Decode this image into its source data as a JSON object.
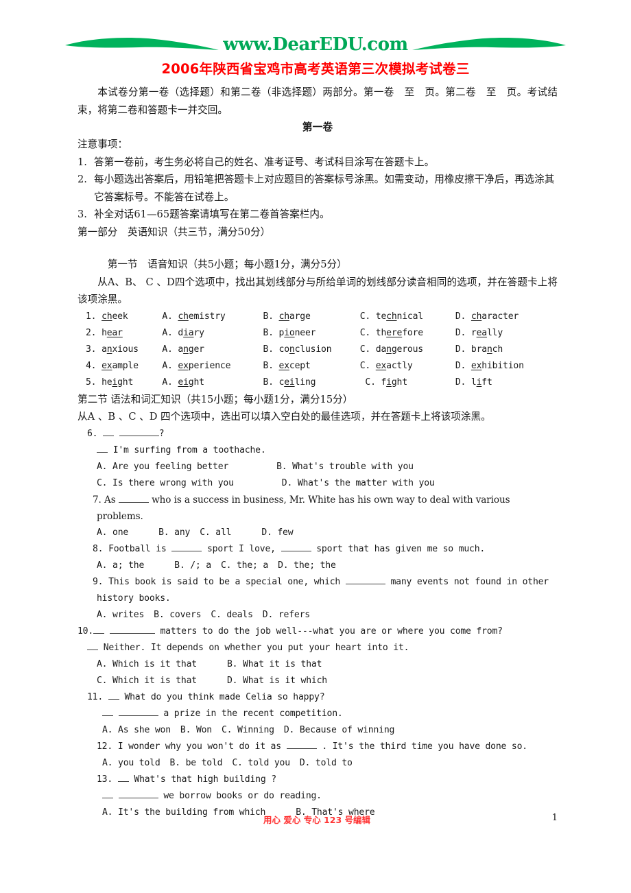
{
  "header": {
    "logo_text": "www.DearEDU.com",
    "logo_color": "#00a857",
    "title": "2006年陕西省宝鸡市高考英语第三次模拟考试卷三",
    "title_color": "#ff0000"
  },
  "intro": {
    "paragraph": "本试卷分第一卷（选择题）和第二卷（非选择题）两部分。第一卷　至　页。第二卷　至　页。考试结束，将第二卷和答题卡一并交回。",
    "volume_heading": "第一卷"
  },
  "notes": {
    "heading": "注意事项：",
    "items": [
      {
        "num": "1.",
        "text": "答第一卷前，考生务必将自己的姓名、准考证号、考试科目涂写在答题卡上。"
      },
      {
        "num": "2.",
        "text": "每小题选出答案后，用铅笔把答题卡上对应题目的答案标号涂黑。如需变动，用橡皮擦干净后，再选涂其它答案标号。不能答在试卷上。"
      },
      {
        "num": "3.",
        "text": "补全对话61—65题答案请填写在第二卷首答案栏内。"
      }
    ]
  },
  "part1": {
    "heading": "第一部分　英语知识（共三节，满分50分）",
    "section1": {
      "heading": "第一节　语音知识（共5小题；每小题1分，满分5分）",
      "instruction": "从A、B、 C 、D四个选项中，找出其划线部分与所给单词的划线部分读音相同的选项，并在答题卡上将该项涂黑。",
      "questions": [
        {
          "num": "1.",
          "stem": {
            "pre": "",
            "u": "ch",
            "post": "eek"
          },
          "options": [
            {
              "label": "A.",
              "pre": "",
              "u": "ch",
              "post": "emistry"
            },
            {
              "label": "B.",
              "pre": "",
              "u": "ch",
              "post": "arge"
            },
            {
              "label": "C.",
              "pre": "te",
              "u": "ch",
              "post": "nical"
            },
            {
              "label": "D.",
              "pre": "",
              "u": "ch",
              "post": "aracter"
            }
          ]
        },
        {
          "num": "2.",
          "stem": {
            "pre": "h",
            "u": "ear",
            "post": ""
          },
          "options": [
            {
              "label": "A.",
              "pre": "d",
              "u": "ia",
              "post": "ry"
            },
            {
              "label": "B.",
              "pre": "p",
              "u": "io",
              "post": "neer"
            },
            {
              "label": "C.",
              "pre": "th",
              "u": "ere",
              "post": "fore"
            },
            {
              "label": "D.",
              "pre": "r",
              "u": "ea",
              "post": "lly"
            }
          ]
        },
        {
          "num": "3.",
          "stem": {
            "pre": "a",
            "u": "n",
            "post": "xious"
          },
          "options": [
            {
              "label": "A.",
              "pre": "a",
              "u": "n",
              "post": "ger"
            },
            {
              "label": "B.",
              "pre": "co",
              "u": "n",
              "post": "clusion"
            },
            {
              "label": "C.",
              "pre": "da",
              "u": "n",
              "post": "gerous"
            },
            {
              "label": "D.",
              "pre": "bra",
              "u": "n",
              "post": "ch"
            }
          ]
        },
        {
          "num": "4.",
          "stem": {
            "pre": "",
            "u": "ex",
            "post": "ample"
          },
          "options": [
            {
              "label": "A.",
              "pre": "",
              "u": "ex",
              "post": "perience"
            },
            {
              "label": "B.",
              "pre": "",
              "u": "ex",
              "post": "cept"
            },
            {
              "label": "C.",
              "pre": "",
              "u": "ex",
              "post": "actly"
            },
            {
              "label": "D.",
              "pre": "",
              "u": "ex",
              "post": "hibition"
            }
          ]
        },
        {
          "num": "5.",
          "stem": {
            "pre": "he",
            "u": "i",
            "post": "ght"
          },
          "options": [
            {
              "label": "A.",
              "pre": "",
              "u": "ei",
              "post": "ght"
            },
            {
              "label": "B.",
              "pre": "c",
              "u": "ei",
              "post": "ling"
            },
            {
              "label": "C.",
              "pre": "f",
              "u": "i",
              "post": "ght"
            },
            {
              "label": "D.",
              "pre": "l",
              "u": "i",
              "post": "ft"
            }
          ]
        }
      ]
    },
    "section2": {
      "heading": "第二节 语法和词汇知识（共15小题；每小题1分，满分15分）",
      "instruction": "从A 、B 、C 、D 四个选项中，选出可以填入空白处的最佳选项，并在答题卡上将该项涂黑。"
    }
  },
  "questions": {
    "q6": {
      "num": "6.",
      "line1_suffix": "?",
      "line2": "I'm surfing from a toothache.",
      "optA": "A. Are you feeling better",
      "optB": "B. What's trouble with you",
      "optC": "C. Is there wrong with you",
      "optD": "D. What's the matter with you"
    },
    "q7": {
      "num": "7.",
      "stem_pre": "As",
      "stem_post": "who is a success in business, Mr. White has his own way to deal with various",
      "stem_cont": "problems.",
      "optA": "A. one",
      "optB": "B. any",
      "optC": "C. all",
      "optD": "D. few"
    },
    "q8": {
      "num": "8.",
      "stem_pre": "Football is",
      "stem_mid": "sport I love,",
      "stem_post": "sport that has given me so much.",
      "optA": "A. a; the",
      "optB": "B. /; a",
      "optC": "C. the; a",
      "optD": "D. the; the"
    },
    "q9": {
      "num": "9.",
      "stem_pre": "This book is said to be a special one, which",
      "stem_post": "many events not found in other",
      "stem_cont": "history books.",
      "optA": "A. writes",
      "optB": "B. covers",
      "optC": "C. deals",
      "optD": "D. refers"
    },
    "q10": {
      "num": "10.",
      "line1_post": "matters to do the job well---what you are or where you come from?",
      "line2": "Neither. It depends on whether you put your heart into it.",
      "optA": "A. Which is it that",
      "optB": "B. What it is that",
      "optC": "C. Which it is that",
      "optD": "D. What is it which"
    },
    "q11": {
      "num": "11.",
      "line1": "What do you think made Celia so happy?",
      "line2_post": "a prize in the recent competition.",
      "optA": "A. As she won",
      "optB": "B. Won",
      "optC": "C. Winning",
      "optD": "D. Because of winning"
    },
    "q12": {
      "num": "12.",
      "stem_pre": "I wonder why you won't do it as",
      "stem_post": ". It's the third time you have done so.",
      "optA": "A. you told",
      "optB": "B. be told",
      "optC": "C. told you",
      "optD": "D. told to"
    },
    "q13": {
      "num": "13.",
      "line1": "What's that high building ?",
      "line2_post": "we borrow books or do reading.",
      "optA": "A. It's the building from which",
      "optB": "B. That's where"
    }
  },
  "footer": {
    "note": "用心 爱心 专心   123 号编辑",
    "page_number": "1",
    "note_color": "#ff3333"
  }
}
